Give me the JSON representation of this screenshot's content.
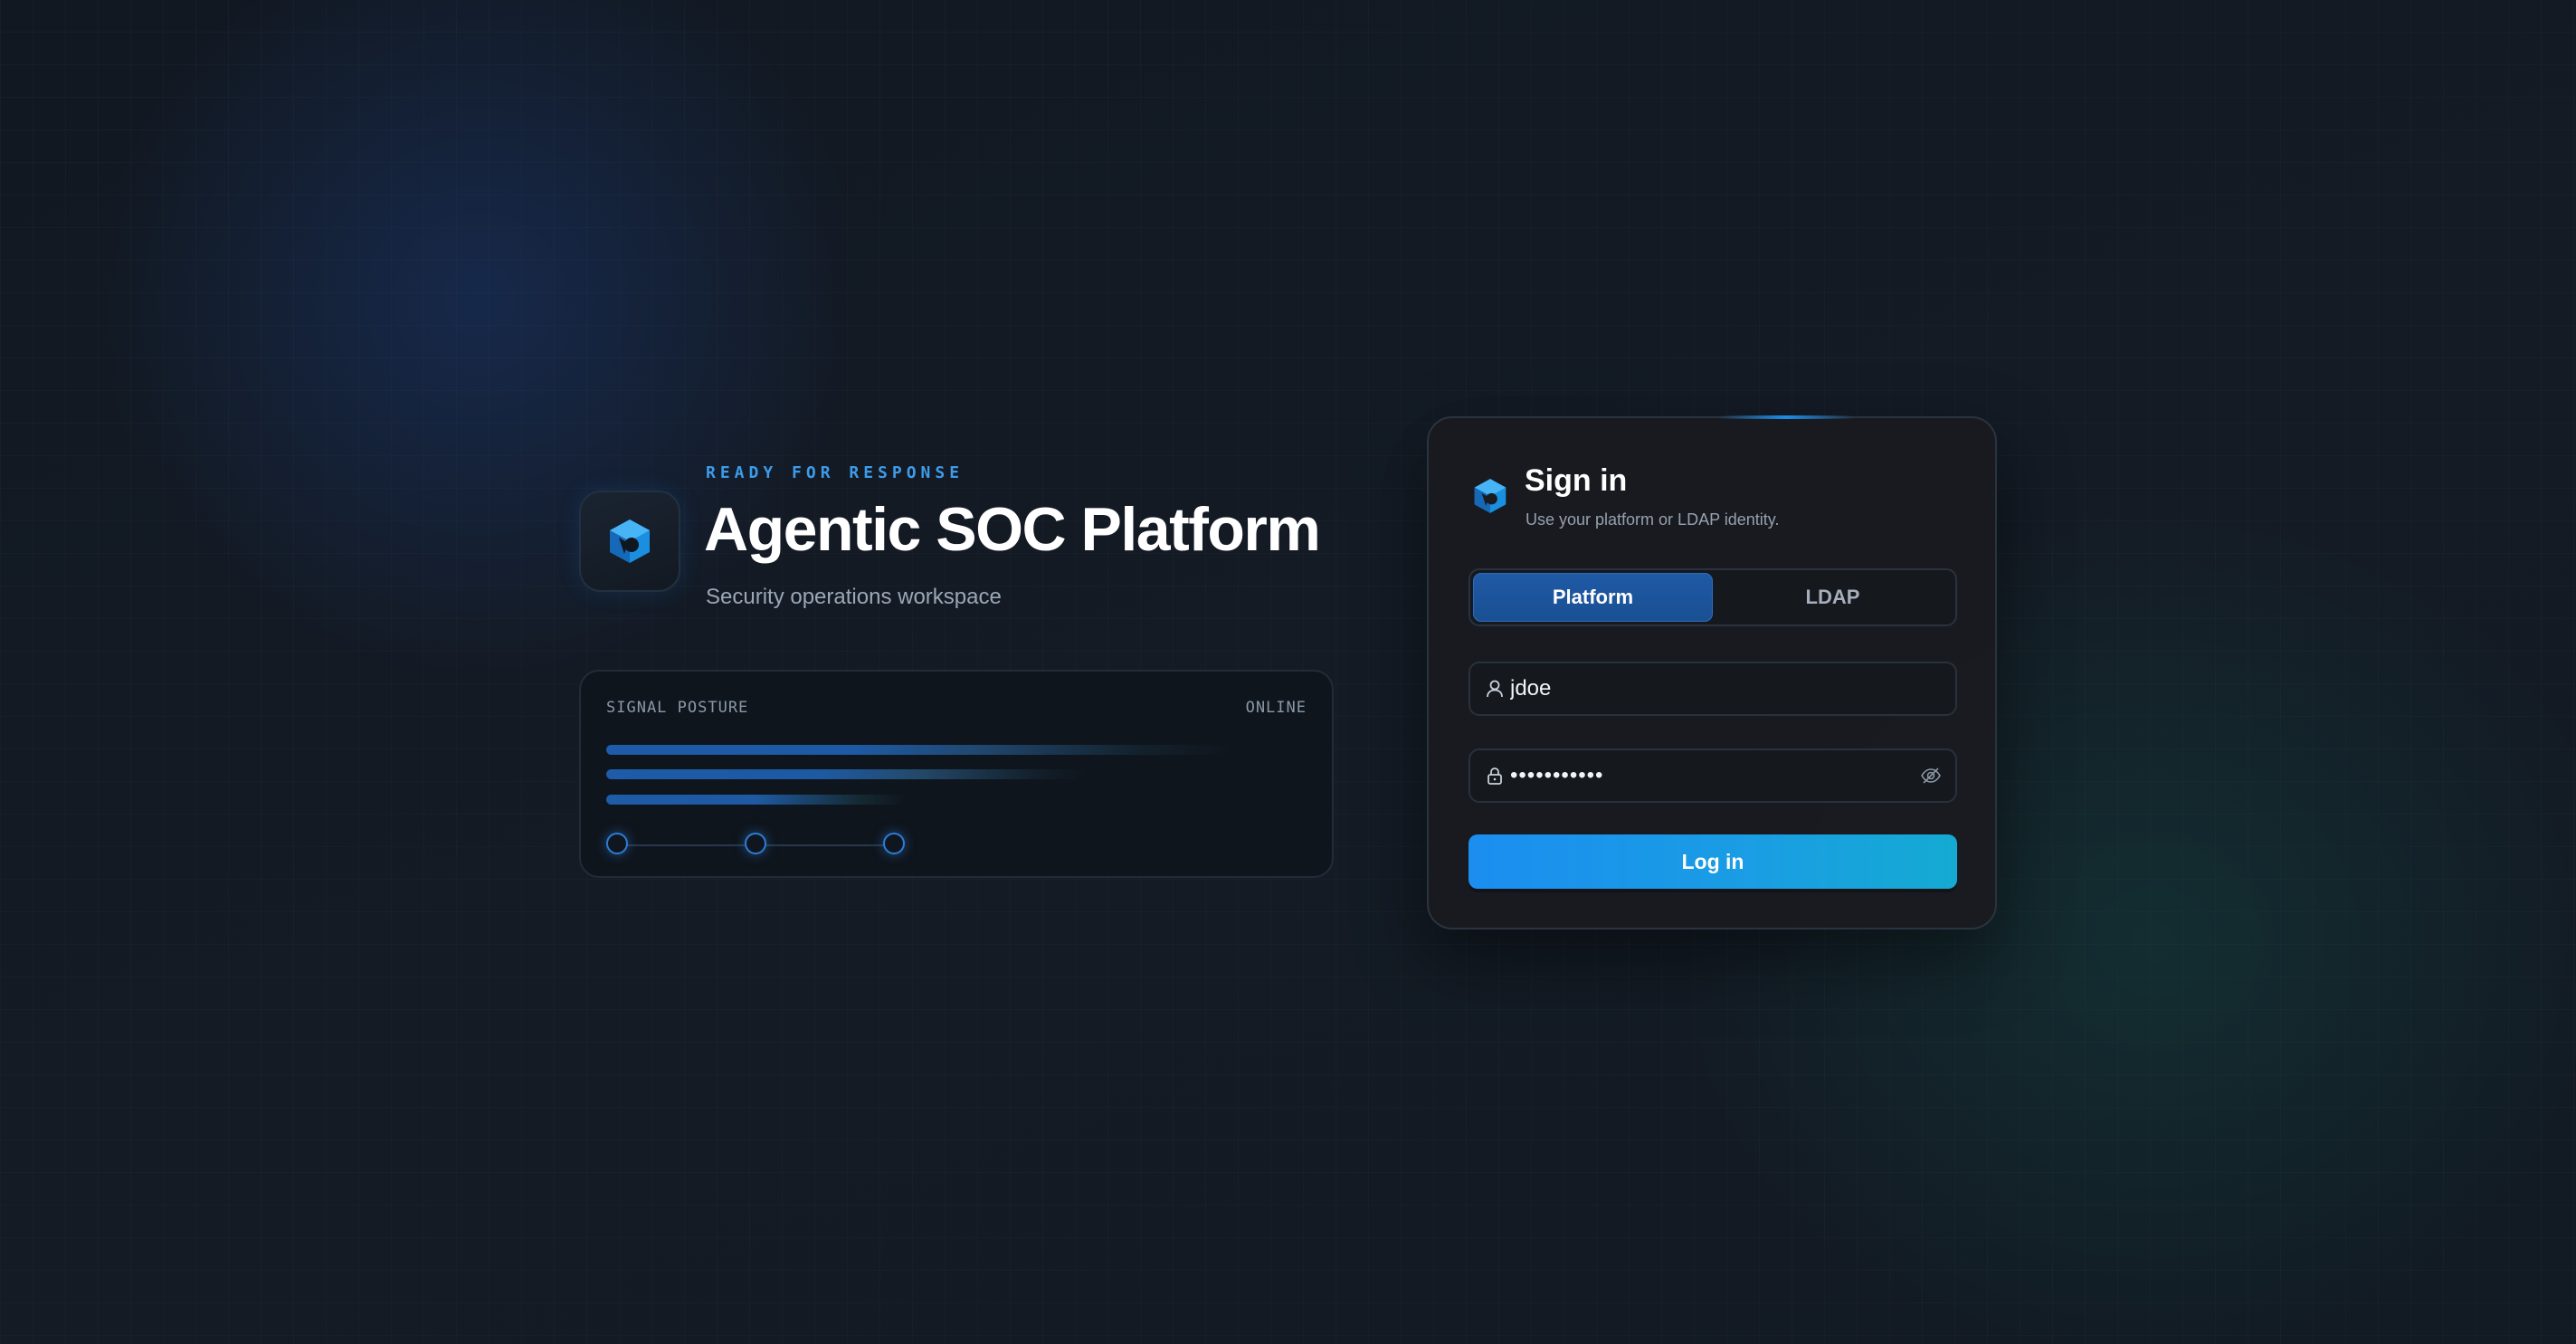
{
  "hero": {
    "eyebrow": "READY FOR RESPONSE",
    "title": "Agentic SOC Platform",
    "subtitle": "Security operations workspace"
  },
  "posture": {
    "label": "SIGNAL POSTURE",
    "status": "ONLINE"
  },
  "signin": {
    "title": "Sign in",
    "subtitle": "Use your platform or LDAP identity.",
    "tabs": [
      {
        "label": "Platform",
        "active": true
      },
      {
        "label": "LDAP",
        "active": false
      }
    ],
    "username_value": "jdoe",
    "password_value": "•••••••••••",
    "login_label": "Log in"
  },
  "icons": {
    "brand": "shield-cube-logo-icon",
    "user": "user-icon",
    "lock": "lock-icon",
    "visibility": "eye-off-icon"
  },
  "colors": {
    "accent": "#1e8ce6",
    "tab_active": "#1f5aa6",
    "eyebrow": "#3d9be9",
    "button_start": "#1b8ef0",
    "button_end": "#14aad2"
  }
}
